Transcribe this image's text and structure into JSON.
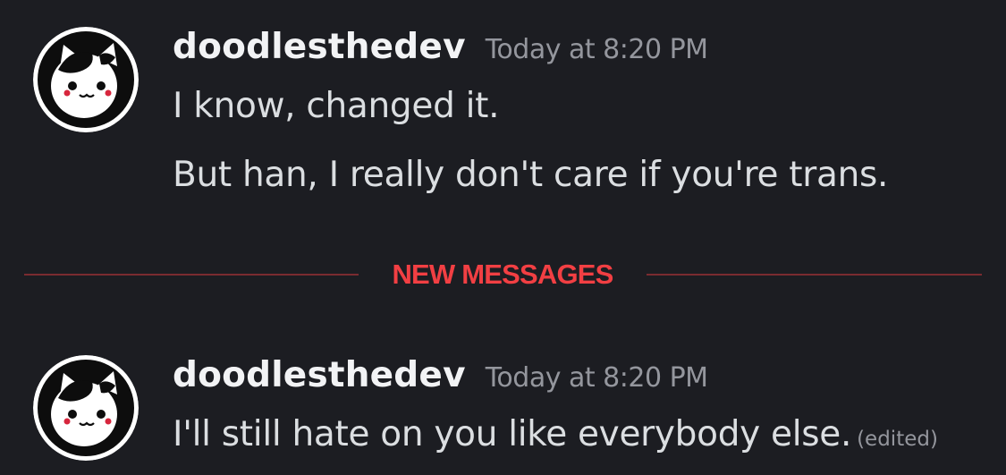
{
  "messages": [
    {
      "username": "doodlesthedev",
      "timestamp": "Today at 8:20 PM",
      "lines": [
        "I know, changed it.",
        "But han, I really don't care if you're trans."
      ]
    },
    {
      "username": "doodlesthedev",
      "timestamp": "Today at 8:20 PM",
      "lines": [
        "I'll still hate on you like everybody else."
      ],
      "edited": "(edited)"
    }
  ],
  "divider": {
    "label": "NEW MESSAGES"
  },
  "colors": {
    "background": "#1c1d22",
    "username": "#f2f3f5",
    "text": "#dbdee1",
    "muted": "#94969d",
    "new_messages": "#f23f43"
  },
  "icons": {
    "avatar": "cat-avatar-icon"
  }
}
